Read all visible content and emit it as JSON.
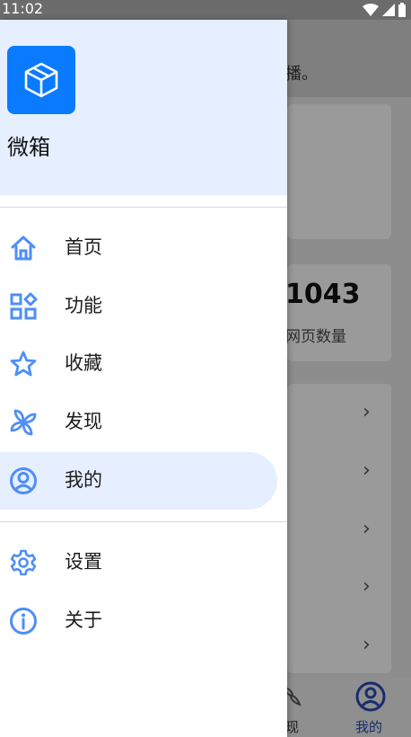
{
  "status_bar": {
    "time": "11:02"
  },
  "background": {
    "header_text": "播。",
    "stat_value": "1043",
    "stat_label": "网页数量",
    "bottom_nav": [
      {
        "label": "现"
      },
      {
        "label": "我的"
      }
    ]
  },
  "drawer": {
    "app_name": "微箱",
    "items": [
      {
        "label": "首页",
        "icon": "home-icon"
      },
      {
        "label": "功能",
        "icon": "apps-icon"
      },
      {
        "label": "收藏",
        "icon": "star-icon"
      },
      {
        "label": "发现",
        "icon": "pinwheel-icon"
      },
      {
        "label": "我的",
        "icon": "account-icon",
        "active": true
      }
    ],
    "secondary_items": [
      {
        "label": "设置",
        "icon": "gear-icon"
      },
      {
        "label": "关于",
        "icon": "info-icon"
      }
    ]
  },
  "colors": {
    "accent": "#0a7bff",
    "header_bg": "#e6efff",
    "icon": "#4f8ef7"
  }
}
